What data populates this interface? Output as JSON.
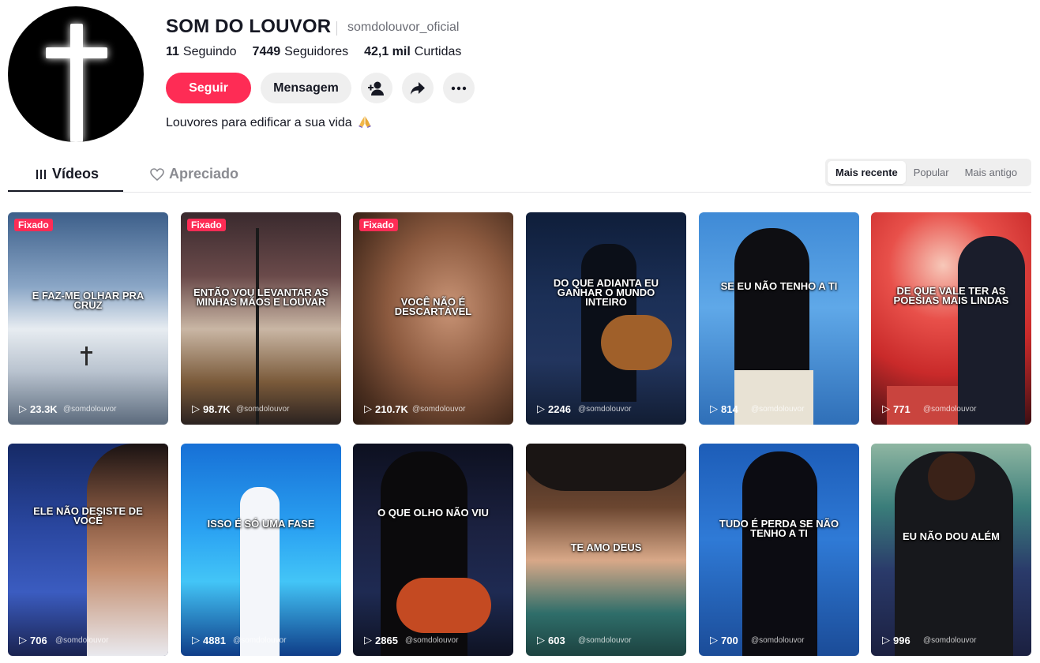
{
  "profile": {
    "name": "SOM DO LOUVOR",
    "handle": "somdolouvor_oficial",
    "stats": {
      "following_value": "11",
      "following_label": "Seguindo",
      "followers_value": "7449",
      "followers_label": "Seguidores",
      "likes_value": "42,1 mil",
      "likes_label": "Curtidas"
    },
    "follow_label": "Seguir",
    "message_label": "Mensagem",
    "bio": "Louvores para edificar a sua vida"
  },
  "tabs": {
    "videos": "Vídeos",
    "liked": "Apreciado"
  },
  "sort": {
    "recent": "Mais recente",
    "popular": "Popular",
    "oldest": "Mais antigo"
  },
  "colors": {
    "accent": "#fe2c55",
    "text": "#161823",
    "muted": "#8a8b91"
  },
  "videos": [
    {
      "pinned": "Fixado",
      "caption": "E FAZ-ME OLHAR PRA CRUZ",
      "views": "23.3K",
      "watermark": "@somdolouvor"
    },
    {
      "pinned": "Fixado",
      "caption": "ENTÃO VOU LEVANTAR AS MINHAS MÃOS E LOUVAR",
      "views": "98.7K",
      "watermark": "@somdolouvor"
    },
    {
      "pinned": "Fixado",
      "caption": "VOCÊ NÃO É DESCARTÁVEL",
      "views": "210.7K",
      "watermark": "@somdolouvor"
    },
    {
      "caption": "DO QUE ADIANTA EU GANHAR O MUNDO INTEIRO",
      "views": "2246",
      "watermark": "@somdolouvor"
    },
    {
      "caption": "SE EU NÃO TENHO A TI",
      "views": "814",
      "watermark": "@somdolouvor"
    },
    {
      "caption": "DE QUE VALE TER AS POESIAS MAIS LINDAS",
      "views": "771",
      "watermark": "@somdolouvor"
    },
    {
      "caption": "ELE NÃO DESISTE DE VOCÊ",
      "views": "706",
      "watermark": "@somdolouvor"
    },
    {
      "caption": "ISSO É SÓ UMA FASE",
      "views": "4881",
      "watermark": "@somdolouvor"
    },
    {
      "caption": "O QUE OLHO NÃO VIU",
      "views": "2865",
      "watermark": "@somdolouvor"
    },
    {
      "caption": "TE AMO DEUS",
      "views": "603",
      "watermark": "@somdolouvor"
    },
    {
      "caption": "TUDO É PERDA SE NÃO TENHO A TI",
      "views": "700",
      "watermark": "@somdolouvor"
    },
    {
      "caption": "EU NÃO DOU ALÉM",
      "views": "996",
      "watermark": "@somdolouvor"
    }
  ]
}
